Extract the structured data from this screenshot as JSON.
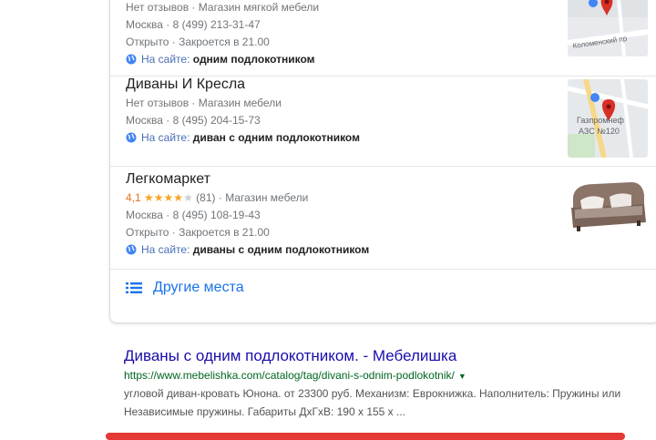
{
  "listings": [
    {
      "reviews": "Нет отзывов",
      "category": "Магазин мягкой мебели",
      "phone": "Москва · 8 (499) 213-31-47",
      "hours": "Открыто · Закроется в 21.00",
      "site_prefix": "На сайте:",
      "site_match": "одним подлокотником",
      "map_label": "Коломенский пр"
    },
    {
      "title": "Диваны И Кресла",
      "reviews": "Нет отзывов",
      "category": "Магазин мебели",
      "phone": "Москва · 8 (495) 204-15-73",
      "site_prefix": "На сайте:",
      "site_match": "диван с одним подлокотником",
      "map_label_1": "Газпромнеф",
      "map_label_2": "АЗС №120"
    },
    {
      "title": "Легкомаркет",
      "rating": "4,1",
      "stars": "★★★★",
      "star_empty": "★",
      "review_count": "(81)",
      "category": "Магазин мебели",
      "phone": "Москва · 8 (495) 108-19-43",
      "hours": "Открыто · Закроется в 21.00",
      "site_prefix": "На сайте:",
      "site_match": "диваны с одним подлокотником"
    }
  ],
  "more_places": "Другие места",
  "result": {
    "title": "Диваны с одним подлокотником. - Мебелишка",
    "url": "https://www.mebelishka.com/catalog/tag/divani-s-odnim-podlokotnik/",
    "url_arrow": "▼",
    "snippet": "угловой диван-кровать Юнона. от 23300 руб. Механизм: Еврокнижка. Наполнитель: Пружины или Независимые пружины. Габариты ДхГхВ: 190 х 155 х ..."
  },
  "colors": {
    "link": "#1a0dab",
    "url": "#006621",
    "accent": "#1a73e8",
    "star": "#f5a623",
    "map_pin": "#d93025"
  }
}
